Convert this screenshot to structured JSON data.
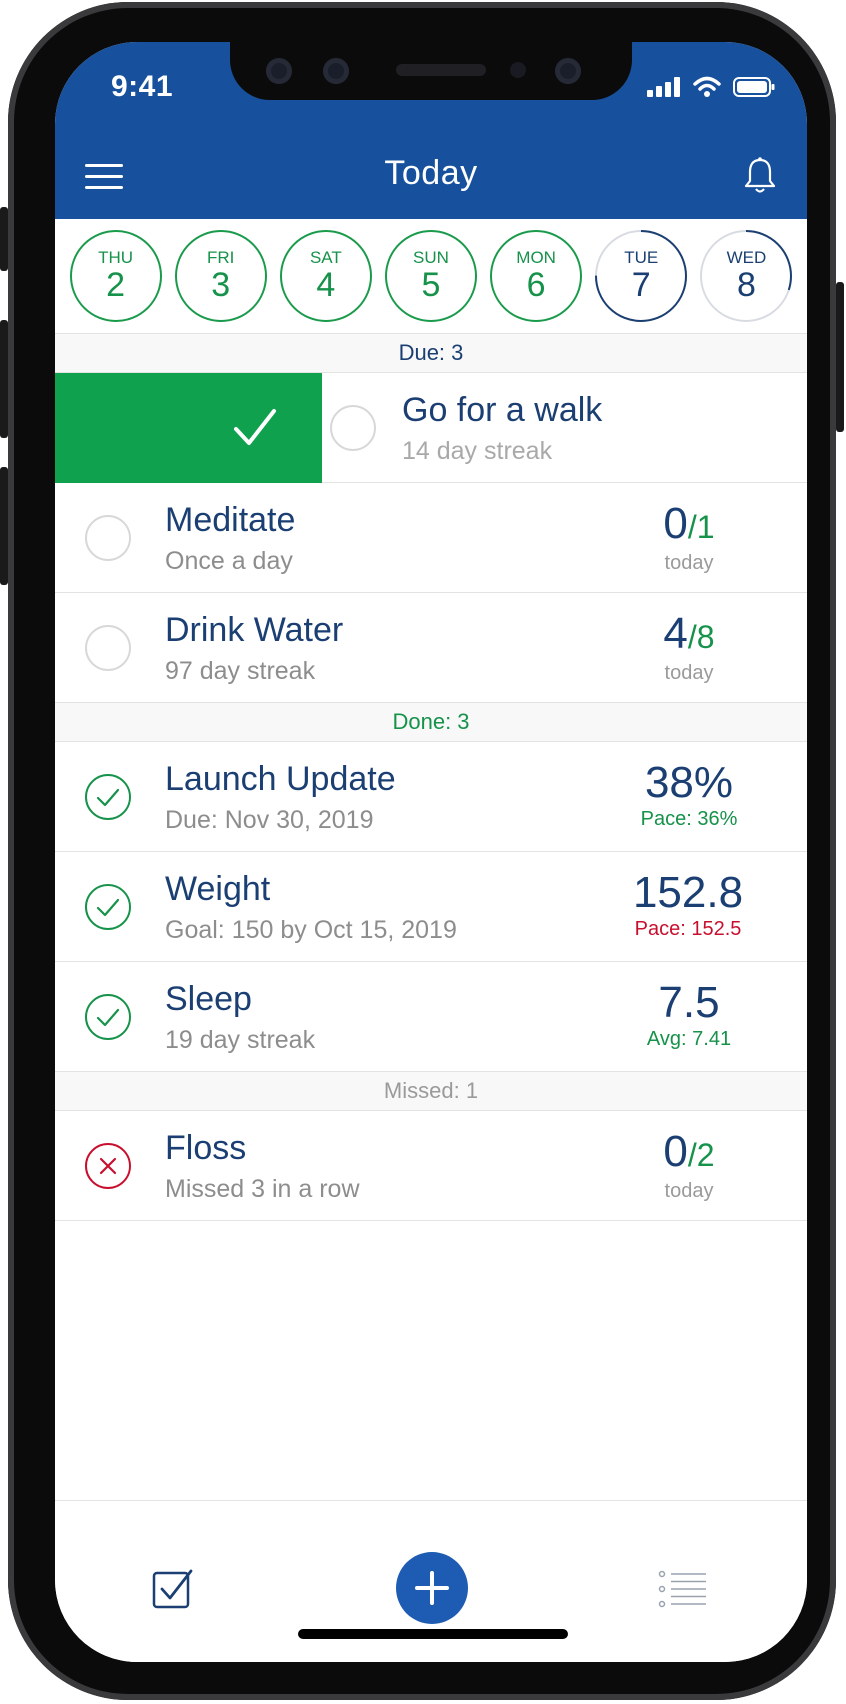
{
  "status_bar": {
    "time": "9:41"
  },
  "header": {
    "title": "Today"
  },
  "days": [
    {
      "name": "THU",
      "date": "2",
      "progress": 1.0
    },
    {
      "name": "FRI",
      "date": "3",
      "progress": 1.0
    },
    {
      "name": "SAT",
      "date": "4",
      "progress": 1.0
    },
    {
      "name": "SUN",
      "date": "5",
      "progress": 1.0
    },
    {
      "name": "MON",
      "date": "6",
      "progress": 1.0
    },
    {
      "name": "TUE",
      "date": "7",
      "progress": 0.75
    },
    {
      "name": "WED",
      "date": "8",
      "progress": 0.3
    }
  ],
  "sections": {
    "due": "Due: 3",
    "done": "Done: 3",
    "missed": "Missed: 1"
  },
  "due_items": [
    {
      "name": "Go for a walk",
      "sub": "14 day streak"
    },
    {
      "name": "Meditate",
      "sub": "Once a day",
      "value": "0",
      "goal": "/1",
      "unit": "today"
    },
    {
      "name": "Drink Water",
      "sub": "97 day streak",
      "value": "4",
      "goal": "/8",
      "unit": "today"
    }
  ],
  "done_items": [
    {
      "name": "Launch Update",
      "sub": "Due: Nov 30, 2019",
      "value": "38%",
      "note": "Pace: 36%",
      "note_color": "#16924a"
    },
    {
      "name": "Weight",
      "sub": "Goal: 150 by Oct 15, 2019",
      "value": "152.8",
      "note": "Pace: 152.5",
      "note_color": "#c8102e"
    },
    {
      "name": "Sleep",
      "sub": "19 day streak",
      "value": "7.5",
      "note": "Avg: 7.41",
      "note_color": "#16924a"
    }
  ],
  "missed_items": [
    {
      "name": "Floss",
      "sub": "Missed 3 in a row",
      "value": "0",
      "goal": "/2",
      "unit": "today"
    }
  ],
  "colors": {
    "header": "#17509c",
    "done": "#16924a",
    "missed": "#c8102e",
    "swipe": "#0fa14d",
    "fab": "#1e5cb3"
  },
  "icons": [
    "menu-icon",
    "bell-icon",
    "check-icon",
    "x-icon",
    "checkbox-tab-icon",
    "plus-icon",
    "list-icon"
  ]
}
